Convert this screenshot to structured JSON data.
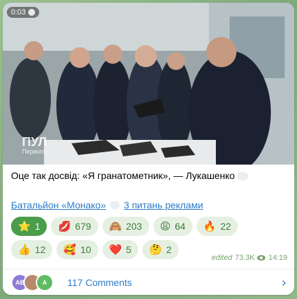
{
  "post": {
    "video_duration": "0:03",
    "watermark_line1": "ПУЛ",
    "watermark_line2": "Первого",
    "caption": "Оце так досвід: «Я гранатометник», — Лукашенко",
    "link1": "Батальйон «Монако»",
    "link2": "3 питань реклами",
    "meta_edited": "edited",
    "meta_views": "73.3K",
    "meta_time": "14:19",
    "comments_label": "117 Comments",
    "avatars": [
      "AB",
      "",
      "A"
    ]
  },
  "reactions": [
    [
      {
        "emoji": "⭐",
        "count": "1",
        "active": true
      },
      {
        "emoji": "💋",
        "count": "679"
      },
      {
        "emoji": "🙈",
        "count": "203"
      },
      {
        "emoji": "😩",
        "count": "64"
      },
      {
        "emoji": "🔥",
        "count": "22"
      }
    ],
    [
      {
        "emoji": "👍",
        "count": "12"
      },
      {
        "emoji": "🥰",
        "count": "10"
      },
      {
        "emoji": "❤️",
        "count": "5"
      },
      {
        "emoji": "🤔",
        "count": "2"
      }
    ]
  ],
  "colors": {
    "accent_link": "#2b7ac7",
    "chip_bg": "#e6f0e2",
    "chip_text": "#3a7d3a",
    "chip_active_bg": "#4a9d4a"
  }
}
